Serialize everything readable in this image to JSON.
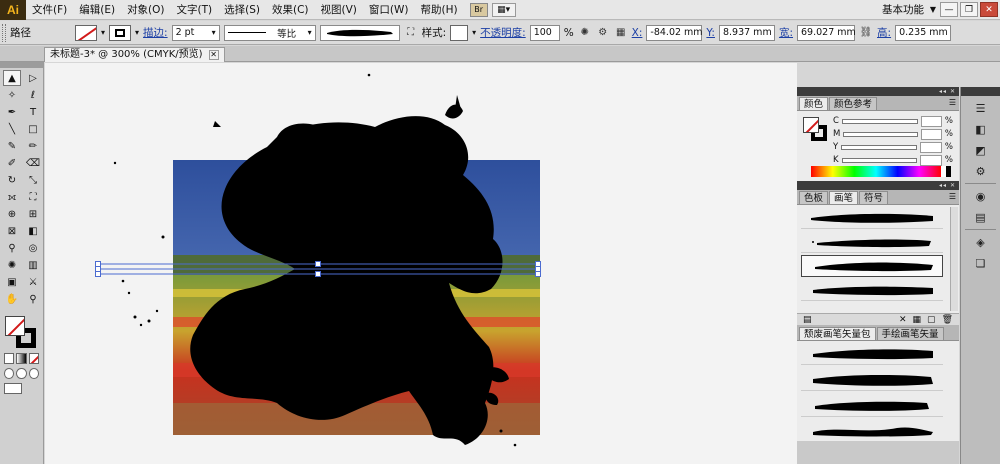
{
  "menubar": {
    "logo": "Ai",
    "items": [
      "文件(F)",
      "编辑(E)",
      "对象(O)",
      "文字(T)",
      "选择(S)",
      "效果(C)",
      "视图(V)",
      "窗口(W)",
      "帮助(H)"
    ],
    "bridge": "Br",
    "workspace": "基本功能"
  },
  "controlbar": {
    "selection_type": "路径",
    "stroke_label": "描边:",
    "stroke_weight": "2 pt",
    "profile_label": "等比",
    "style_label": "样式:",
    "opacity_label": "不透明度:",
    "opacity_value": "100",
    "opacity_unit": "%",
    "x_label": "X:",
    "x_value": "-84.02 mm",
    "y_label": "Y:",
    "y_value": "8.937 mm",
    "w_label": "宽:",
    "w_value": "69.027 mm",
    "h_label": "高:",
    "h_value": "0.235 mm"
  },
  "document_tab": {
    "title": "未标题-3* @ 300% (CMYK/预览)"
  },
  "color_panel": {
    "tabs": [
      "颜色",
      "颜色参考"
    ],
    "channels": [
      "C",
      "M",
      "Y",
      "K"
    ],
    "unit": "%"
  },
  "brush_panel": {
    "tabs": [
      "色板",
      "画笔",
      "符号"
    ]
  },
  "library_panel": {
    "tabs": [
      "颓废画笔矢量包",
      "手绘画笔矢量"
    ]
  },
  "colors": {
    "ui_bg": "#d6d6d6",
    "canvas_bg": "#f3f3f3",
    "accent_link": "#1c3fa5",
    "none_red": "#d21a1a"
  }
}
